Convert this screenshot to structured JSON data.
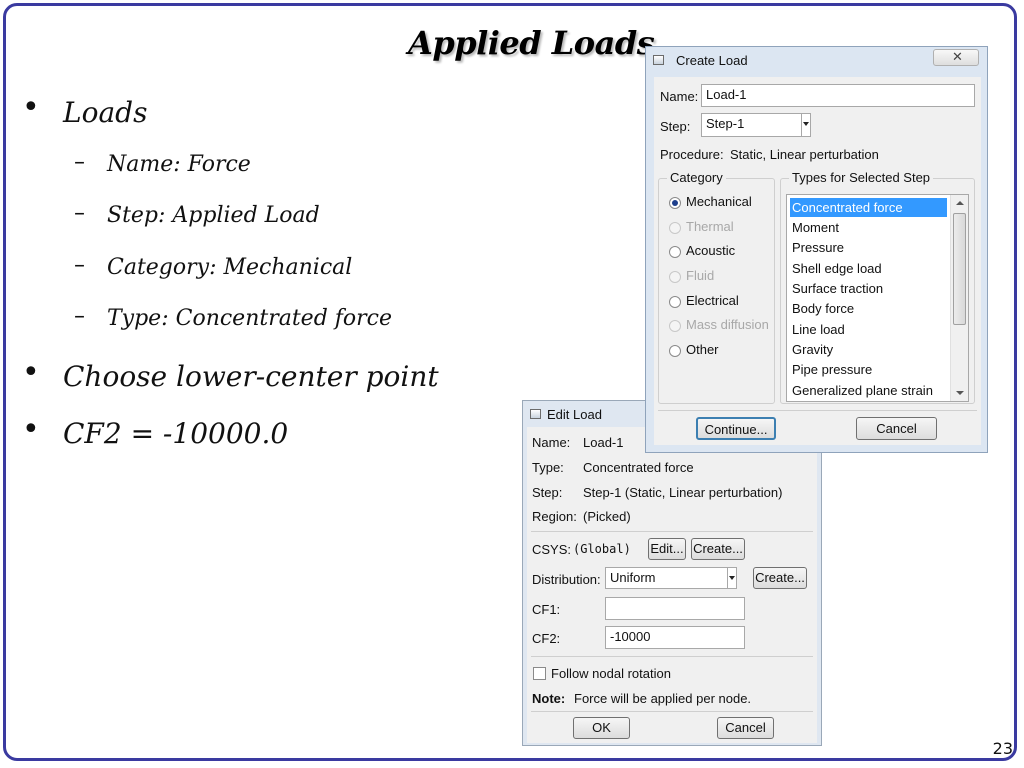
{
  "slide": {
    "title": "Applied Loads",
    "page_number": "23",
    "bullets": [
      {
        "text": "Loads",
        "subitems": [
          "Name: Force",
          "Step: Applied Load",
          "Category: Mechanical",
          "Type: Concentrated force"
        ]
      },
      {
        "text": "Choose lower-center point"
      },
      {
        "text": "CF2 = -10000.0"
      }
    ]
  },
  "create_load": {
    "title": "Create Load",
    "name_label": "Name:",
    "name_value": "Load-1",
    "step_label": "Step:",
    "step_value": "Step-1",
    "procedure_label": "Procedure:",
    "procedure_value": "Static, Linear perturbation",
    "category_label": "Category",
    "categories": [
      {
        "label": "Mechanical",
        "selected": true,
        "enabled": true
      },
      {
        "label": "Thermal",
        "selected": false,
        "enabled": false
      },
      {
        "label": "Acoustic",
        "selected": false,
        "enabled": true
      },
      {
        "label": "Fluid",
        "selected": false,
        "enabled": false
      },
      {
        "label": "Electrical",
        "selected": false,
        "enabled": true
      },
      {
        "label": "Mass diffusion",
        "selected": false,
        "enabled": false
      },
      {
        "label": "Other",
        "selected": false,
        "enabled": true
      }
    ],
    "types_label": "Types for Selected Step",
    "types": [
      "Concentrated force",
      "Moment",
      "Pressure",
      "Shell edge load",
      "Surface traction",
      "Body force",
      "Line load",
      "Gravity",
      "Pipe pressure",
      "Generalized plane strain"
    ],
    "selected_type": "Concentrated force",
    "continue_label": "Continue...",
    "cancel_label": "Cancel"
  },
  "edit_load": {
    "title": "Edit Load",
    "name_label": "Name:",
    "name_value": "Load-1",
    "type_label": "Type:",
    "type_value": "Concentrated force",
    "step_label": "Step:",
    "step_value": "Step-1 (Static, Linear perturbation)",
    "region_label": "Region:",
    "region_value": "(Picked)",
    "csys_label": "CSYS:",
    "csys_value": "(Global)",
    "edit_label": "Edit...",
    "create_label": "Create...",
    "distribution_label": "Distribution:",
    "distribution_value": "Uniform",
    "dist_create_label": "Create...",
    "cf1_label": "CF1:",
    "cf1_value": "",
    "cf2_label": "CF2:",
    "cf2_value": "-10000",
    "follow_label": "Follow nodal rotation",
    "follow_checked": false,
    "note_label": "Note:",
    "note_text": "Force will be applied per node.",
    "ok_label": "OK",
    "cancel_label": "Cancel"
  }
}
